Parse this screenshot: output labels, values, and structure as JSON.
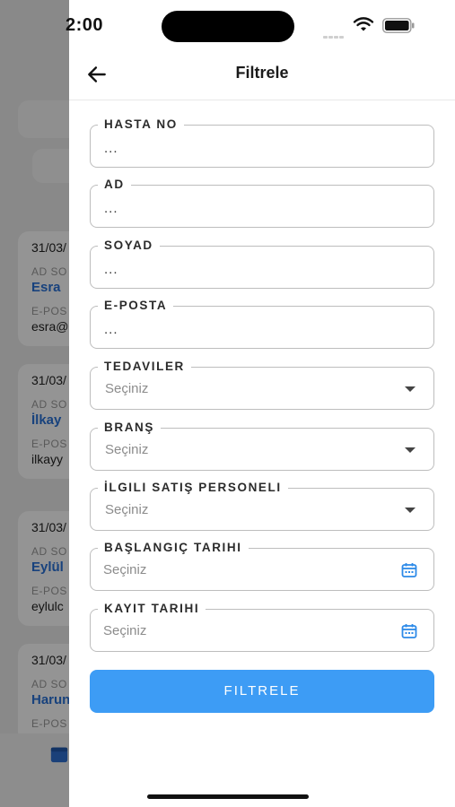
{
  "status_bar": {
    "time": "2:00"
  },
  "background_list": {
    "cards": [
      {
        "date": "31/03/",
        "name_label": "AD SO",
        "name": "Esra ",
        "email_label": "E-POS",
        "email": "esra@"
      },
      {
        "date": "31/03/",
        "name_label": "AD SO",
        "name": "İlkay ",
        "email_label": "E-POS",
        "email": "ilkayy"
      },
      {
        "date": "31/03/",
        "name_label": "AD SO",
        "name": "Eylül ",
        "email_label": "E-POS",
        "email": "eylulc"
      },
      {
        "date": "31/03/",
        "name_label": "AD SO",
        "name": "Harun",
        "email_label": "E-POS",
        "email": ""
      }
    ]
  },
  "drawer": {
    "title": "Filtrele",
    "fields": [
      {
        "label": "HASTA NO",
        "value": "...",
        "type": "text"
      },
      {
        "label": "AD",
        "value": "...",
        "type": "text"
      },
      {
        "label": "SOYAD",
        "value": "...",
        "type": "text"
      },
      {
        "label": "E-POSTA",
        "value": "...",
        "type": "text"
      },
      {
        "label": "TEDAVILER",
        "placeholder": "Seçiniz",
        "type": "select"
      },
      {
        "label": "BRANŞ",
        "placeholder": "Seçiniz",
        "type": "select"
      },
      {
        "label": "İLGILI SATIŞ PERSONELI",
        "placeholder": "Seçiniz",
        "type": "select"
      },
      {
        "label": "BAŞLANGIÇ TARIHI",
        "placeholder": "Seçiniz",
        "type": "date"
      },
      {
        "label": "KAYIT TARIHI",
        "placeholder": "Seçiniz",
        "type": "date"
      }
    ],
    "submit_label": "FILTRELE"
  },
  "colors": {
    "accent": "#3d9cf5",
    "link": "#2a73d8",
    "calendar_icon": "#2d8ae8"
  }
}
